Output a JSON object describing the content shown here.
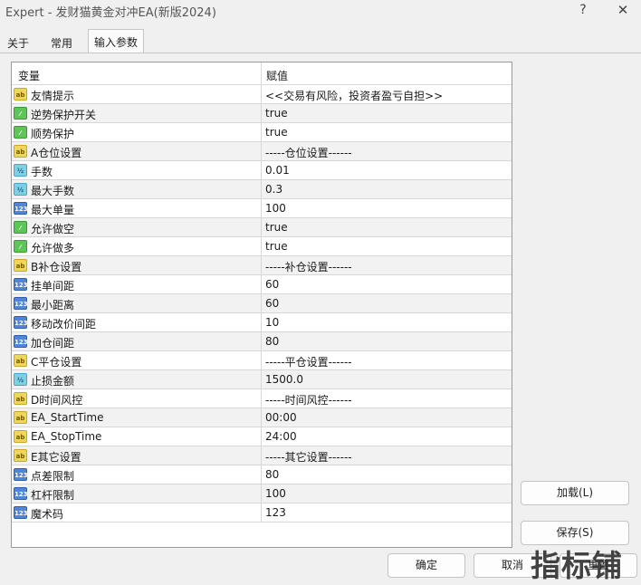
{
  "window": {
    "title": "Expert - 发财猫黄金对冲EA(新版2024)",
    "help_glyph": "?",
    "close_glyph": "✕"
  },
  "tabs": [
    {
      "label": "关于"
    },
    {
      "label": "常用"
    },
    {
      "label": "输入参数"
    }
  ],
  "table": {
    "header": {
      "name": "变量",
      "value": "赋值"
    },
    "rows": [
      {
        "type": "string",
        "icon_text": "ab",
        "name": "友情提示",
        "value": "<<交易有风险，投资者盈亏自担>>"
      },
      {
        "type": "bool",
        "icon_text": "⁄",
        "name": "逆势保护开关",
        "value": "true"
      },
      {
        "type": "bool",
        "icon_text": "⁄",
        "name": "顺势保护",
        "value": "true"
      },
      {
        "type": "string",
        "icon_text": "ab",
        "name": "A仓位设置",
        "value": "-----仓位设置------"
      },
      {
        "type": "double",
        "icon_text": "½",
        "name": "手数",
        "value": "0.01"
      },
      {
        "type": "double",
        "icon_text": "½",
        "name": "最大手数",
        "value": "0.3"
      },
      {
        "type": "int",
        "icon_text": "123",
        "name": "最大单量",
        "value": "100"
      },
      {
        "type": "bool",
        "icon_text": "⁄",
        "name": "允许做空",
        "value": "true"
      },
      {
        "type": "bool",
        "icon_text": "⁄",
        "name": "允许做多",
        "value": "true"
      },
      {
        "type": "string",
        "icon_text": "ab",
        "name": "B补仓设置",
        "value": "-----补仓设置------"
      },
      {
        "type": "int",
        "icon_text": "123",
        "name": "挂单间距",
        "value": "60"
      },
      {
        "type": "int",
        "icon_text": "123",
        "name": "最小距离",
        "value": "60"
      },
      {
        "type": "int",
        "icon_text": "123",
        "name": "移动改价间距",
        "value": "10"
      },
      {
        "type": "int",
        "icon_text": "123",
        "name": "加仓间距",
        "value": "80"
      },
      {
        "type": "string",
        "icon_text": "ab",
        "name": "C平仓设置",
        "value": "-----平仓设置------"
      },
      {
        "type": "double",
        "icon_text": "½",
        "name": "止损金额",
        "value": "1500.0"
      },
      {
        "type": "string",
        "icon_text": "ab",
        "name": "D时间风控",
        "value": "-----时间风控------"
      },
      {
        "type": "string",
        "icon_text": "ab",
        "name": "EA_StartTime",
        "value": "00:00"
      },
      {
        "type": "string",
        "icon_text": "ab",
        "name": "EA_StopTime",
        "value": "24:00"
      },
      {
        "type": "string",
        "icon_text": "ab",
        "name": "E其它设置",
        "value": "-----其它设置------"
      },
      {
        "type": "int",
        "icon_text": "123",
        "name": "点差限制",
        "value": "80"
      },
      {
        "type": "int",
        "icon_text": "123",
        "name": "杠杆限制",
        "value": "100"
      },
      {
        "type": "int",
        "icon_text": "123",
        "name": "魔术码",
        "value": "123"
      }
    ]
  },
  "buttons": {
    "load": "加载(L)",
    "save": "保存(S)",
    "ok": "确定",
    "cancel": "取消",
    "reset": "重置"
  },
  "watermark": "指标铺",
  "colors": {
    "string_icon": "#f2d65a",
    "bool_icon": "#5fc45a",
    "double_icon": "#7fd0e6",
    "int_icon": "#4f86d9"
  }
}
